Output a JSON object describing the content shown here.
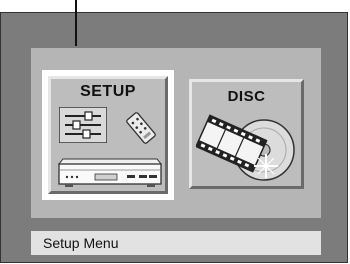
{
  "menu": {
    "items": [
      {
        "label": "SETUP",
        "selected": true,
        "icon": "setup-icon"
      },
      {
        "label": "DISC",
        "selected": false,
        "icon": "disc-icon"
      }
    ]
  },
  "status": {
    "text": "Setup Menu"
  },
  "colors": {
    "screen_background": "#7c7c7c",
    "panel_background": "#b5b5b5",
    "selected_highlight": "#ffffff",
    "status_bar_background": "#e2e2e2"
  }
}
